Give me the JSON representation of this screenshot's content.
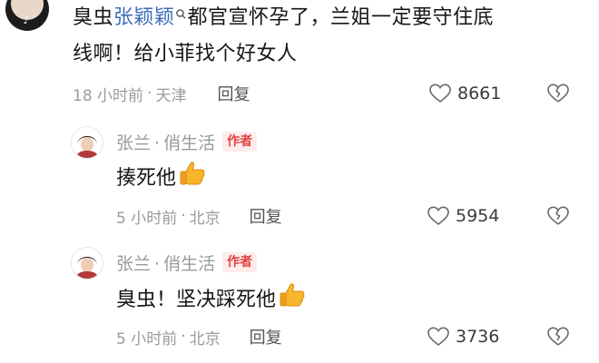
{
  "top_comment": {
    "text_part1": "臭虫",
    "mention": "张颖颖",
    "text_part2": "都官宣怀孕了，兰姐一定要守住底",
    "text_line2": "线啊！给小菲找个好女人",
    "time": "18 小时前",
    "location": "天津",
    "reply_label": "回复",
    "likes": "8661"
  },
  "replies": [
    {
      "author": "张兰",
      "channel": "俏生活",
      "badge": "作者",
      "text": "揍死他",
      "emoji": "thumbs-up",
      "time": "5 小时前",
      "location": "北京",
      "reply_label": "回复",
      "likes": "5954"
    },
    {
      "author": "张兰",
      "channel": "俏生活",
      "badge": "作者",
      "text": "臭虫！坚决踩死他",
      "emoji": "thumbs-up",
      "time": "5 小时前",
      "location": "北京",
      "reply_label": "回复",
      "likes": "3736"
    }
  ],
  "separator": "·",
  "colors": {
    "mention": "#3f6db8",
    "badge_text": "#e0423f",
    "badge_bg": "#fdeceb",
    "meta_text": "#9a9a9a",
    "thumb": "#f7b52c"
  },
  "icons": [
    "heart-outline-icon",
    "broken-heart-icon",
    "search-icon",
    "thumbs-up-emoji",
    "tiktok-icon"
  ]
}
